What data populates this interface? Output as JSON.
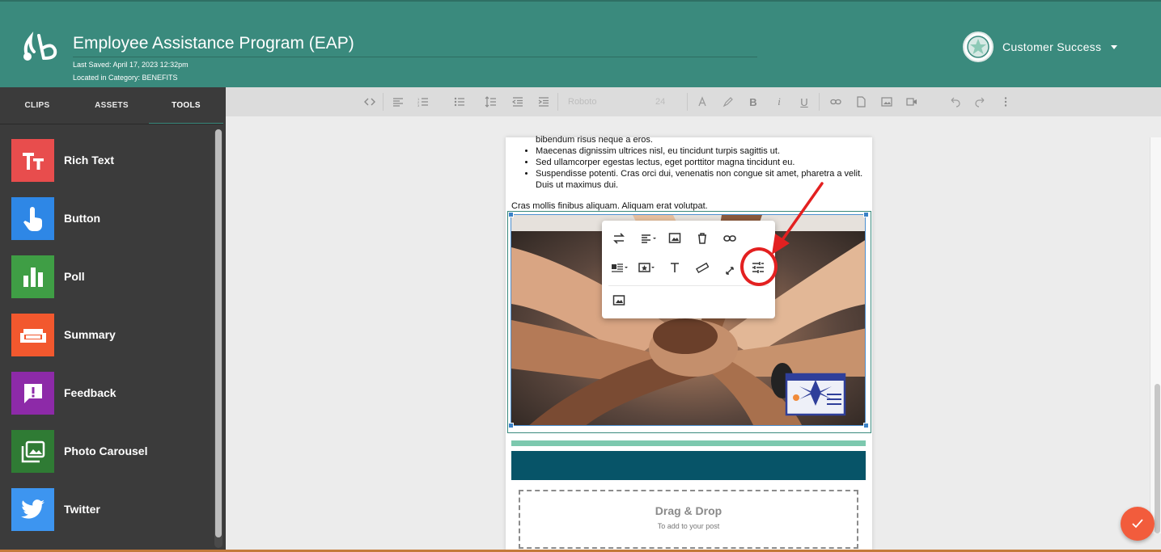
{
  "header": {
    "title": "Employee Assistance Program (EAP)",
    "last_saved": "Last Saved: April 17, 2023 12:32pm",
    "category": "Located in Category: BENEFITS",
    "user_name": "Customer Success",
    "bg_color": "#3a8a7d"
  },
  "sidebar": {
    "tabs": [
      {
        "label": "CLIPS"
      },
      {
        "label": "ASSETS"
      },
      {
        "label": "TOOLS"
      }
    ],
    "active_tab": "TOOLS",
    "tools": [
      {
        "label": "Rich Text",
        "color": "#e84d4d",
        "icon": "rich-text-icon"
      },
      {
        "label": "Button",
        "color": "#2e87e6",
        "icon": "tap-hand-icon"
      },
      {
        "label": "Poll",
        "color": "#3f9e45",
        "icon": "bar-chart-icon"
      },
      {
        "label": "Summary",
        "color": "#f2582e",
        "icon": "couch-icon"
      },
      {
        "label": "Feedback",
        "color": "#8d2aa8",
        "icon": "feedback-icon"
      },
      {
        "label": "Photo Carousel",
        "color": "#2f7b34",
        "icon": "photo-library-icon"
      },
      {
        "label": "Twitter",
        "color": "#3d95f0",
        "icon": "twitter-icon"
      }
    ]
  },
  "toolbar": {
    "font_name": "Roboto",
    "font_size": "24",
    "icons": [
      "code-view-icon",
      "align-icon",
      "ordered-list-icon",
      "unordered-list-icon",
      "line-height-icon",
      "outdent-icon",
      "indent-icon",
      "font-family-select",
      "font-size-select",
      "text-color-icon",
      "highlight-icon",
      "bold-icon",
      "italic-icon",
      "underline-icon",
      "link-icon",
      "file-icon",
      "image-icon",
      "video-icon",
      "undo-icon",
      "redo-icon",
      "more-icon"
    ]
  },
  "content": {
    "partial_top_line": "bibendum risus neque a eros.",
    "bullets": [
      "Maecenas dignissim ultrices nisl, eu tincidunt turpis sagittis ut.",
      "Sed ullamcorper egestas lectus, eget porttitor magna tincidunt eu.",
      "Suspendisse potenti. Cras orci dui, venenatis non congue sit amet, pharetra a velit. Duis ut maximus dui."
    ],
    "paragraph": "Cras mollis finibus aliquam. Aliquam erat volutpat.",
    "image_alt_subject": "stacked hands team photo",
    "dropzone_title": "Drag & Drop",
    "dropzone_subtitle": "To add to your post"
  },
  "image_popup": {
    "row1": [
      "replace-image-icon",
      "align-dropdown-icon",
      "image-caption-icon",
      "delete-icon",
      "link-icon"
    ],
    "row2": [
      "display-dropdown-icon",
      "style-dropdown-icon",
      "alt-text-icon",
      "ruler-size-icon",
      "resize-icon",
      "advanced-settings-icon"
    ],
    "row3": [
      "image-icon"
    ],
    "highlighted": "advanced-settings-icon"
  },
  "colors": {
    "accent": "#3a8a7d",
    "sidebar_bg": "#3b3b3b",
    "fab": "#f25c3c",
    "annotation": "#e32020",
    "bar_light": "#7cc8ae",
    "bar_dark": "#075468"
  }
}
